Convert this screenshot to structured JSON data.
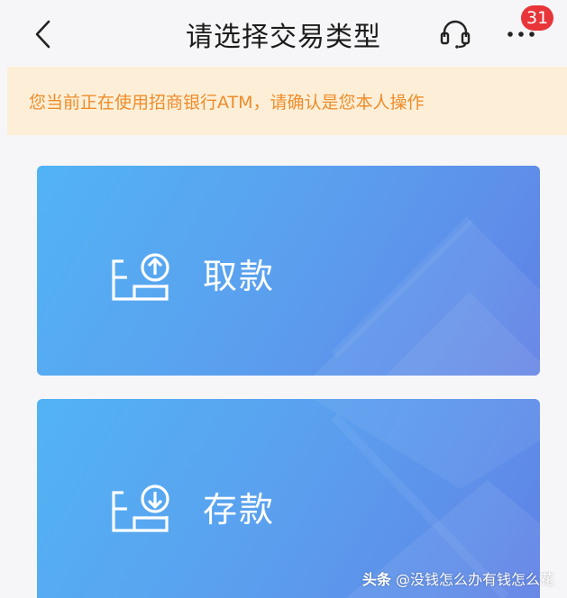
{
  "header": {
    "title": "请选择交易类型",
    "back_icon": "chevron-left-icon",
    "support_icon": "headset-icon",
    "more_icon": "more-horizontal-icon",
    "notification_count": "31",
    "badge_color": "#e8353a"
  },
  "notice": {
    "text": "您当前正在使用招商银行ATM，请确认是您本人操作",
    "text_color": "#ee8c2b",
    "background": "#fdefd7"
  },
  "options": [
    {
      "label": "取款",
      "icon": "withdraw-icon"
    },
    {
      "label": "存款",
      "icon": "deposit-icon"
    }
  ],
  "watermark": {
    "platform": "头条",
    "account": "@没钱怎么办有钱怎么花"
  }
}
